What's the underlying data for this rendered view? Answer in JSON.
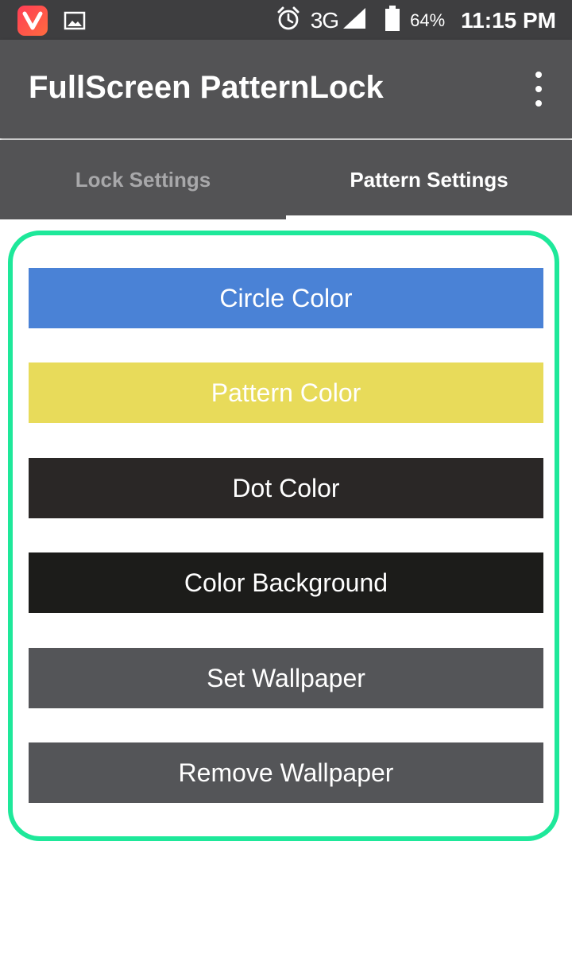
{
  "status_bar": {
    "network": "3G",
    "battery": "64%",
    "time": "11:15 PM",
    "icons": [
      "vidmate-app-icon",
      "gallery-icon",
      "alarm-icon",
      "signal-icon",
      "battery-icon"
    ]
  },
  "app_bar": {
    "title": "FullScreen PatternLock",
    "menu_icon": "more-vert-icon"
  },
  "tabs": [
    {
      "label": "Lock Settings",
      "selected": false
    },
    {
      "label": "Pattern Settings",
      "selected": true
    }
  ],
  "buttons": [
    {
      "label": "Circle Color",
      "color": "#4a82d6"
    },
    {
      "label": "Pattern Color",
      "color": "#e8db5a"
    },
    {
      "label": "Dot Color",
      "color": "#2a2726"
    },
    {
      "label": "Color Background",
      "color": "#1c1c1a"
    },
    {
      "label": "Set Wallpaper",
      "color": "#545558"
    },
    {
      "label": "Remove Wallpaper",
      "color": "#545558"
    }
  ],
  "colors": {
    "status_bar": "#3e3e40",
    "app_bar": "#535355",
    "highlight_frame": "#1ee89a",
    "tab_inactive_text": "#a8a8aa",
    "tab_active_text": "#ffffff"
  }
}
